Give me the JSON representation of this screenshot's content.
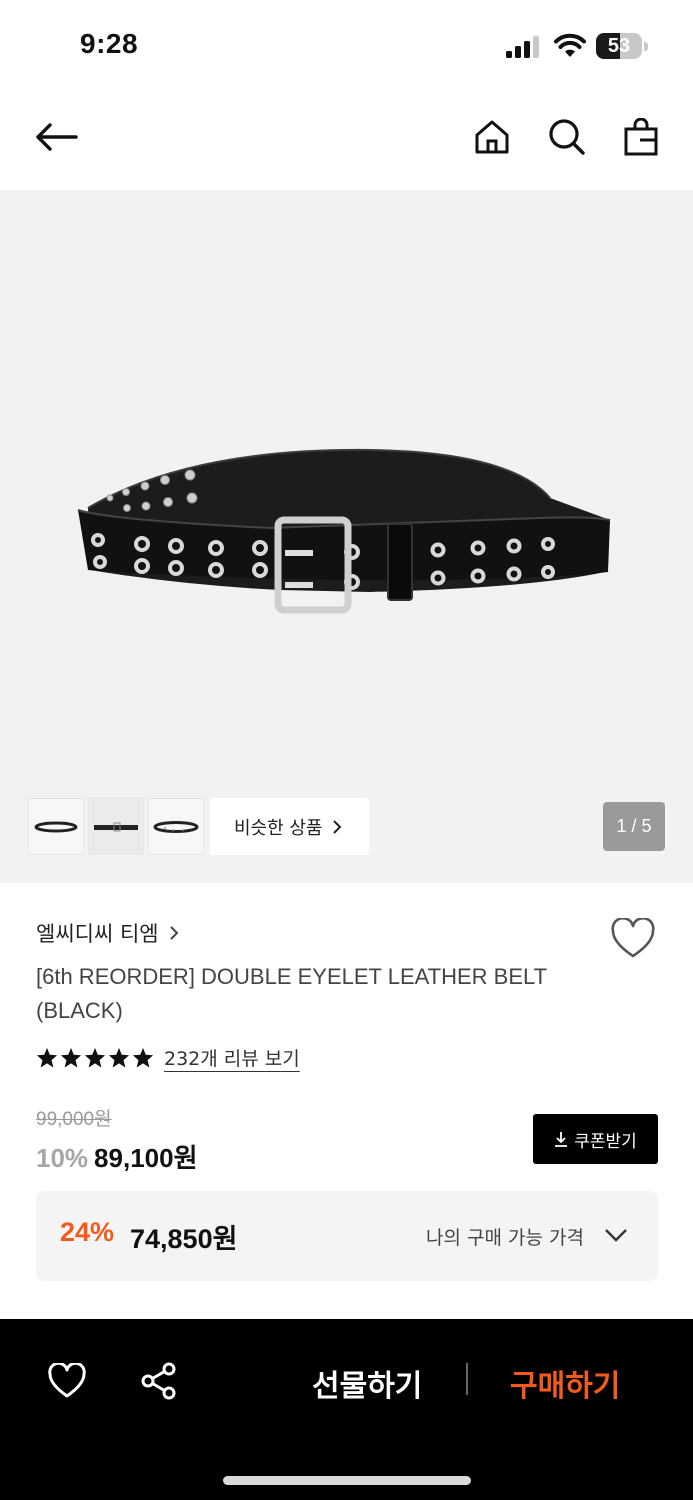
{
  "status_bar": {
    "time": "9:28",
    "battery": "53",
    "battery_level": 0.53
  },
  "header": {
    "icons": [
      "back-arrow-icon",
      "home-icon",
      "search-icon",
      "shopping-bag-icon"
    ]
  },
  "gallery": {
    "similar_label": "비슷한 상품",
    "page_counter": "1 / 5",
    "thumbnail_count": 3
  },
  "product": {
    "brand": "엘씨디씨 티엠",
    "title": "[6th REORDER] DOUBLE EYELET LEATHER BELT (BLACK)",
    "rating_stars": 5,
    "review_link": "232개 리뷰 보기",
    "original_price": "99,000원",
    "discount_rate": "10%",
    "sale_price": "89,100원",
    "coupon_label": "쿠폰받기"
  },
  "my_price": {
    "rate": "24%",
    "price": "74,850원",
    "label": "나의 구매 가능 가격"
  },
  "bottom_bar": {
    "gift_label": "선물하기",
    "buy_label": "구매하기"
  },
  "colors": {
    "accent": "#f35b1c",
    "dark": "#000000"
  }
}
